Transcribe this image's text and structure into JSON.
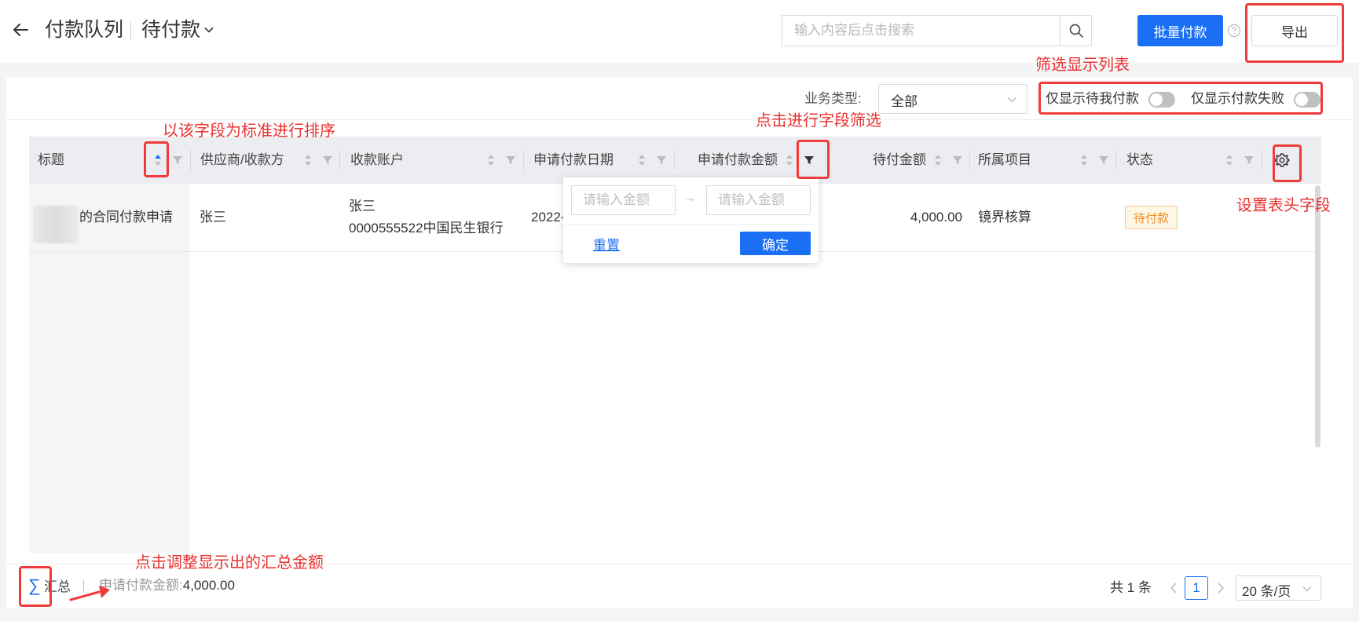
{
  "header": {
    "back_icon": "arrow-left-icon",
    "breadcrumb_root": "付款队列",
    "breadcrumb_current": "待付款",
    "search_placeholder": "输入内容后点击搜索",
    "batch_pay_label": "批量付款",
    "export_label": "导出"
  },
  "filters": {
    "business_type_label": "业务类型:",
    "business_type_value": "全部",
    "switch_pending_mine": "仅显示待我付款",
    "switch_failed": "仅显示付款失败"
  },
  "table": {
    "columns": [
      "标题",
      "供应商/收款方",
      "收款账户",
      "申请付款日期",
      "申请付款金额",
      "待付金额",
      "所属项目",
      "状态"
    ],
    "rows": [
      {
        "title": "的合同付款申请",
        "supplier": "张三",
        "account_name": "张三",
        "account_no": "0000555522中国民生银行",
        "date": "2022-",
        "pending_amount": "4,000.00",
        "project": "镜界核算",
        "status": "待付款"
      }
    ]
  },
  "amount_filter": {
    "min_placeholder": "请输入金额",
    "max_placeholder": "请输入金额",
    "range_arrow": "→",
    "reset_label": "重置",
    "confirm_label": "确定"
  },
  "footer": {
    "sum_symbol": "∑",
    "sum_label": "汇总",
    "sum_field_label": "申请付款金额:",
    "sum_value": "4,000.00",
    "total_text": "共 1 条",
    "current_page": "1",
    "page_size": "20 条/页"
  },
  "annotations": {
    "filter_list": "筛选显示列表",
    "sort": "以该字段为标准进行排序",
    "field_filter": "点击进行字段筛选",
    "header_settings": "设置表头字段",
    "summary": "点击调整显示出的汇总金额"
  },
  "colors": {
    "primary": "#1a6ff5",
    "annotation": "#e8312f",
    "status_pending": "#f08a24"
  }
}
